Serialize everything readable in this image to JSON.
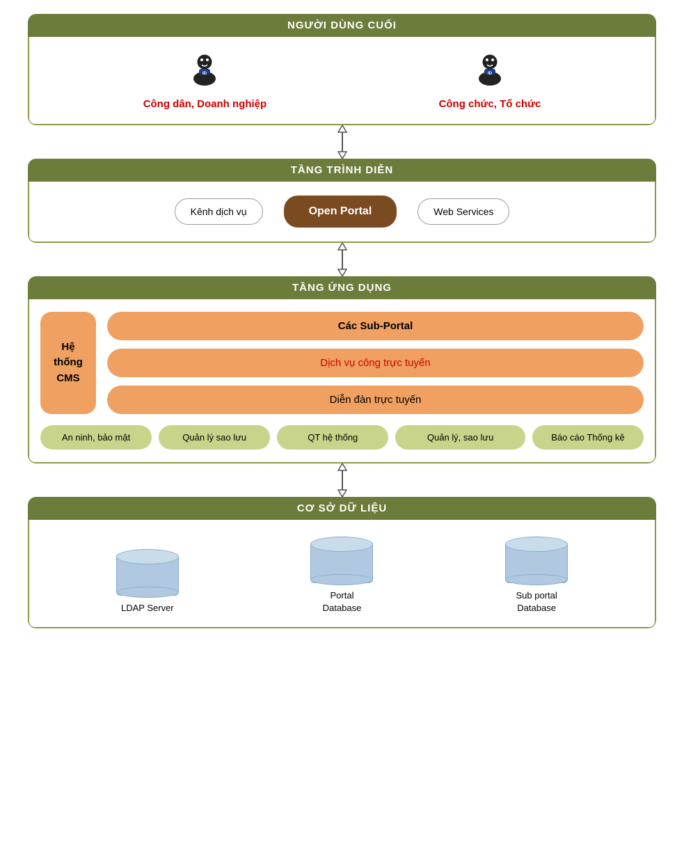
{
  "layers": {
    "nguoi_dung": {
      "header": "NGƯỜI DÙNG CUỐI",
      "users": [
        {
          "label": "Công dân, Doanh nghiệp",
          "icon": "👤"
        },
        {
          "label": "Công chức, Tổ chức",
          "icon": "👤"
        }
      ]
    },
    "trinh_dien": {
      "header": "TẦNG TRÌNH DIỄN",
      "items": [
        {
          "label": "Kênh dịch vụ",
          "style": "normal"
        },
        {
          "label": "Open Portal",
          "style": "brown"
        },
        {
          "label": "Web Services",
          "style": "normal"
        }
      ]
    },
    "ung_dung": {
      "header": "TẦNG ỨNG DỤNG",
      "cms_label": "Hệ thống CMS",
      "sub_portals": [
        {
          "label": "Các Sub-Portal",
          "style": "bold"
        },
        {
          "label": "Dịch vụ công trực tuyến",
          "style": "red"
        },
        {
          "label": "Diễn đàn trực tuyến",
          "style": "normal"
        }
      ],
      "bottom_items": [
        "An ninh, bảo mật",
        "Quản lý sao lưu",
        "QT hệ thống",
        "Quản lý, sao lưu",
        "Báo cáo Thống kê"
      ]
    },
    "co_so_du_lieu": {
      "header": "CƠ SỞ DỮ LIỆU",
      "databases": [
        {
          "label": "LDAP Server"
        },
        {
          "label": "Portal\nDatabase"
        },
        {
          "label": "Sub portal\nDatabase"
        }
      ]
    }
  }
}
